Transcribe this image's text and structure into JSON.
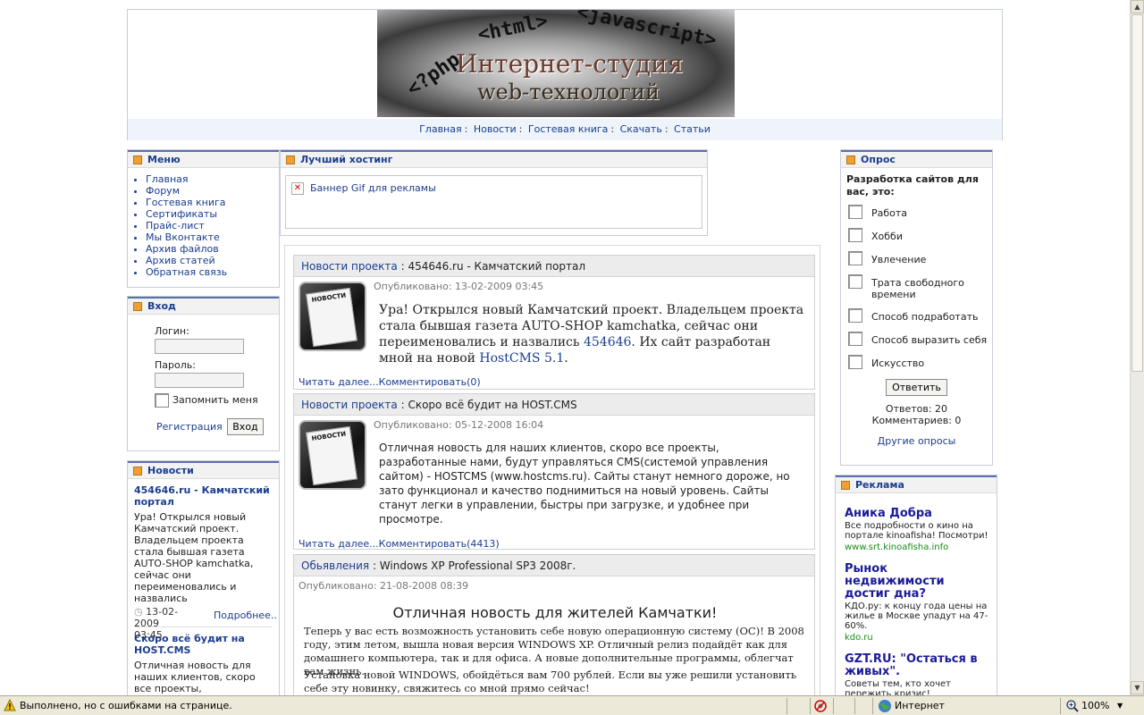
{
  "header": {
    "logo_code": [
      "<?php",
      "<html>",
      "<javascript>"
    ],
    "logo_title1": "Интернет-студия",
    "logo_title2": "web-технологий",
    "nav": [
      "Главная",
      "Новости",
      "Гостевая книга",
      "Скачать",
      "Статьи"
    ]
  },
  "menu": {
    "title": "Меню",
    "items": [
      "Главная",
      "Форум",
      "Гостевая книга",
      "Сертификаты",
      "Прайс-лист",
      "Мы Вконтакте",
      "Архив файлов",
      "Архив статей",
      "Обратная связь"
    ]
  },
  "login": {
    "title": "Вход",
    "login_label": "Логин:",
    "password_label": "Пароль:",
    "remember": "Запомнить меня",
    "register": "Регистрация",
    "submit": "Вход"
  },
  "news_side": {
    "title": "Новости",
    "items": [
      {
        "title": "454646.ru - Камчатский портал",
        "body": "Ура! Открылся новый Камчатский проект. Владельцем проекта стала бывшая газета AUTO-SHOP kamchatka, сейчас они переименовались и назвались",
        "date": "13-02-2009 03:45",
        "more": "Подробнее.."
      },
      {
        "title": "Скоро всё будит на HOST.CMS",
        "body": "Отличная новость для наших клиентов, скоро все проекты, разработанные нами, будут управляться CMS (системой управления"
      }
    ]
  },
  "hosting": {
    "title": "Лучший хостинг",
    "banner_alt": "Баннер Gif для рекламы"
  },
  "articles": [
    {
      "category": "Новости проекта",
      "title": "454646.ru - Камчатский портал",
      "published": "Опубликовано: 13-02-2009 03:45",
      "body_before": "Ура! Открылся новый Камчатский проект. Владельцем проекта стала бывшая газета AUTO-SHOP kamchatka, сейчас они переименовались и назвались ",
      "body_link1": "454646",
      "body_mid": ". Их сайт разработан мной на новой ",
      "body_link2": "HostCMS 5.1",
      "body_end": ".",
      "read_more": "Читать далее...",
      "comments": "Комментировать(0)"
    },
    {
      "category": "Новости проекта",
      "title": "Скоро всё будит на HOST.CMS",
      "published": "Опубликовано: 05-12-2008 16:04",
      "body": "Отличная новость для наших клиентов, скоро все проекты, разработанные нами, будут управляться CMS(системой управления сайтом) - HOSTCMS (www.hostcms.ru). Сайты станут немного дороже, но зато функционал и качество поднимиться на новый уровень. Сайты станут легки в управлении, быстры при загрузке, и удобнее при просмотре.",
      "read_more": "Читать далее...",
      "comments": "Комментировать(4413)"
    },
    {
      "category": "Обьявления",
      "title": "Windows XP Professional SP3 2008г.",
      "published": "Опубликовано: 21-08-2008 08:39",
      "headline": "Отличная новость для жителей Камчатки!",
      "p1": "Теперь у вас есть возможность установить себе новую операционную систему (ОС)! В 2008 году, этим летом, вышла новая версия WINDOWS XP.  Отличный релиз подайдёт как для домашнего компьютера, так и для офиса. А новые дополнительные программы, облегчат вам жизнь.",
      "p2": "Установка новой WINDOWS, обойдёться вам 700 рублей. Если вы уже решили установить себе эту новинку, свяжитесь со мной прямо сейчас!"
    }
  ],
  "poll": {
    "title": "Опрос",
    "question": "Разработка сайтов для вас, это:",
    "options": [
      "Работа",
      "Хобби",
      "Увлечение",
      "Трата свободного времени",
      "Способ подработать",
      "Способ выразить себя",
      "Искусство"
    ],
    "submit": "Ответить",
    "answers": "Ответов: 20",
    "comments": "Комментариев: 0",
    "other": "Другие опросы"
  },
  "ads": {
    "title": "Реклама",
    "items": [
      {
        "title": "Аника Добра",
        "desc": "Все подробности о кино на портале kinoafisha! Посмотри!",
        "url": "www.srt.kinoafisha.info"
      },
      {
        "title": "Рынок недвижимости достиг дна?",
        "desc": "КДО.ру: к концу года цены на жилье в Москве упадут на 47-60%.",
        "url": "kdo.ru"
      },
      {
        "title": "GZT.RU: \"Остаться в живых\".",
        "desc": "Советы тем, кто хочет пережить кризис!",
        "url": ""
      }
    ]
  },
  "statusbar": {
    "message": "Выполнено, но с ошибками на странице.",
    "zone": "Интернет",
    "zoom": "100%"
  }
}
